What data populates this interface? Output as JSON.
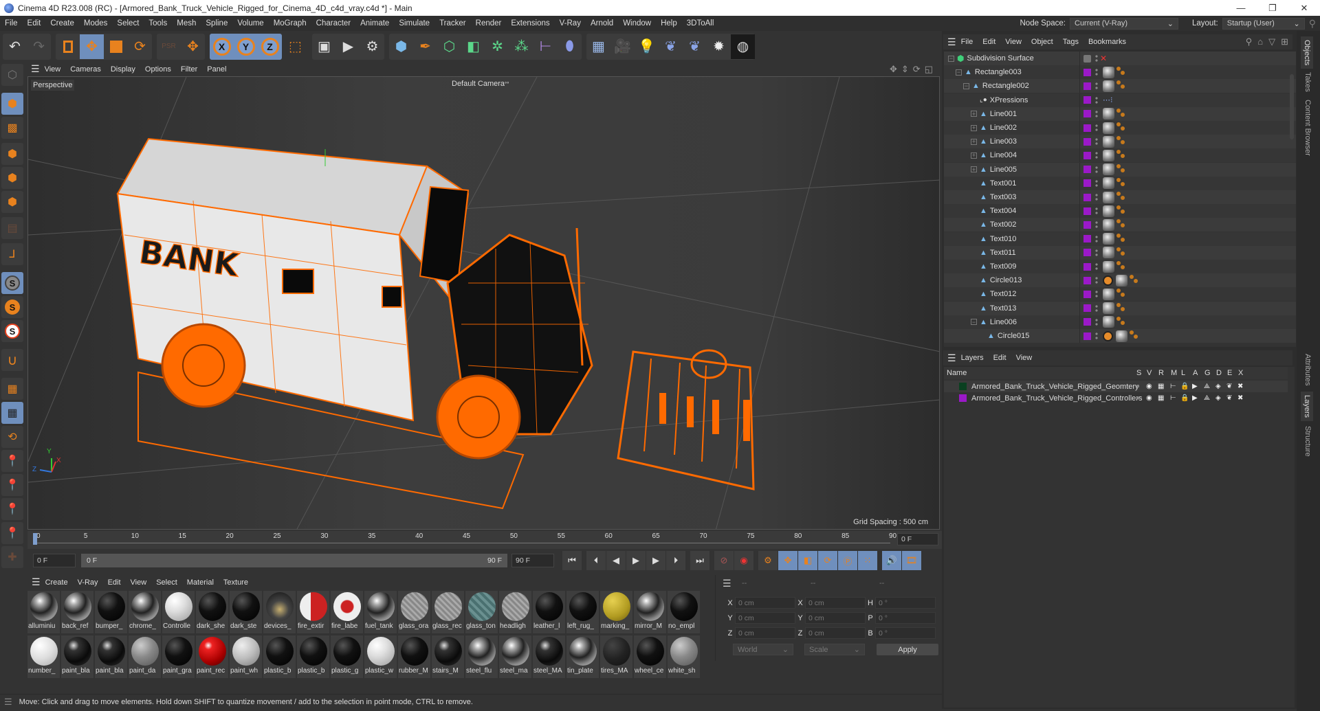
{
  "window": {
    "title": "Cinema 4D R23.008 (RC) - [Armored_Bank_Truck_Vehicle_Rigged_for_Cinema_4D_c4d_vray.c4d *] - Main",
    "minimize": "—",
    "maximize": "❐",
    "close": "✕"
  },
  "menubar": {
    "items": [
      "File",
      "Edit",
      "Create",
      "Modes",
      "Select",
      "Tools",
      "Mesh",
      "Spline",
      "Volume",
      "MoGraph",
      "Character",
      "Animate",
      "Simulate",
      "Tracker",
      "Render",
      "Extensions",
      "V-Ray",
      "Arnold",
      "Window",
      "Help",
      "3DToAll"
    ],
    "node_space_label": "Node Space:",
    "node_space_value": "Current (V-Ray)",
    "layout_label": "Layout:",
    "layout_value": "Startup (User)"
  },
  "toolbar": {
    "x_label": "X",
    "y_label": "Y",
    "z_label": "Z"
  },
  "viewport": {
    "menu": [
      "View",
      "Cameras",
      "Display",
      "Options",
      "Filter",
      "Panel"
    ],
    "view_name": "Perspective",
    "camera": "Default Camera",
    "camera_suffix": "°°",
    "grid_spacing": "Grid Spacing : 500 cm",
    "truck_text": "BANK",
    "axis": {
      "x": "X",
      "y": "Y",
      "z": "Z"
    }
  },
  "timeline": {
    "ticks": [
      "0",
      "5",
      "10",
      "15",
      "20",
      "25",
      "30",
      "35",
      "40",
      "45",
      "50",
      "55",
      "60",
      "65",
      "70",
      "75",
      "80",
      "85",
      "90"
    ],
    "current_frame": "0 F",
    "start_field": "0 F",
    "range_start": "0 F",
    "range_end": "90 F",
    "end_field": "90 F"
  },
  "materials": {
    "menu": [
      "Create",
      "V-Ray",
      "Edit",
      "View",
      "Select",
      "Material",
      "Texture"
    ],
    "items": [
      {
        "name": "alluminiu",
        "look": "chrome"
      },
      {
        "name": "back_ref",
        "look": "chrome"
      },
      {
        "name": "bumper_",
        "look": "black"
      },
      {
        "name": "chrome_",
        "look": "chrome"
      },
      {
        "name": "Controlle",
        "look": "white"
      },
      {
        "name": "dark_she",
        "look": "black"
      },
      {
        "name": "dark_ste",
        "look": "black"
      },
      {
        "name": "devices_",
        "look": "device"
      },
      {
        "name": "fire_extir",
        "look": "red-white"
      },
      {
        "name": "fire_labe",
        "look": "label"
      },
      {
        "name": "fuel_tank",
        "look": "chrome"
      },
      {
        "name": "glass_ora",
        "look": "glass"
      },
      {
        "name": "glass_rec",
        "look": "glass"
      },
      {
        "name": "glass_ton",
        "look": "teal"
      },
      {
        "name": "headligh",
        "look": "glass"
      },
      {
        "name": "leather_l",
        "look": "black"
      },
      {
        "name": "left_rug_",
        "look": "black"
      },
      {
        "name": "marking_",
        "look": "yellow"
      },
      {
        "name": "mirror_M",
        "look": "chrome"
      },
      {
        "name": "no_empl",
        "look": "black"
      },
      {
        "name": "number_",
        "look": "number"
      },
      {
        "name": "paint_bla",
        "look": "black-gloss"
      },
      {
        "name": "paint_bla",
        "look": "black-gloss"
      },
      {
        "name": "paint_da",
        "look": "grey"
      },
      {
        "name": "paint_gra",
        "look": "black"
      },
      {
        "name": "paint_rec",
        "look": "red"
      },
      {
        "name": "paint_wh",
        "look": "white-rough"
      },
      {
        "name": "plastic_b",
        "look": "black"
      },
      {
        "name": "plastic_b",
        "look": "black"
      },
      {
        "name": "plastic_g",
        "look": "black"
      },
      {
        "name": "plastic_w",
        "look": "white"
      },
      {
        "name": "rubber_M",
        "look": "black"
      },
      {
        "name": "stairs_M",
        "look": "black-gloss"
      },
      {
        "name": "steel_flu",
        "look": "chrome"
      },
      {
        "name": "steel_ma",
        "look": "chrome"
      },
      {
        "name": "steel_MA",
        "look": "black-gloss"
      },
      {
        "name": "tin_plate",
        "look": "chrome"
      },
      {
        "name": "tires_MA",
        "look": "dark-rough"
      },
      {
        "name": "wheel_ce",
        "look": "black"
      },
      {
        "name": "white_sh",
        "look": "grey"
      }
    ]
  },
  "coordinates": {
    "headers": [
      "--",
      "--",
      "--"
    ],
    "position": [
      {
        "axis": "X",
        "value": "0 cm"
      },
      {
        "axis": "Y",
        "value": "0 cm"
      },
      {
        "axis": "Z",
        "value": "0 cm"
      }
    ],
    "size": [
      {
        "axis": "X",
        "value": "0 cm"
      },
      {
        "axis": "Y",
        "value": "0 cm"
      },
      {
        "axis": "Z",
        "value": "0 cm"
      }
    ],
    "rotation": [
      {
        "axis": "H",
        "value": "0 °"
      },
      {
        "axis": "P",
        "value": "0 °"
      },
      {
        "axis": "B",
        "value": "0 °"
      }
    ],
    "mode_select": "World",
    "scale_select": "Scale",
    "apply_label": "Apply"
  },
  "status": {
    "text": "Move: Click and drag to move elements. Hold down SHIFT to quantize movement / add to the selection in point mode, CTRL to remove."
  },
  "objects_panel": {
    "menu": [
      "File",
      "Edit",
      "View",
      "Object",
      "Tags",
      "Bookmarks"
    ],
    "items": [
      {
        "name": "Subdivision Surface",
        "depth": 0,
        "icon": "subdivision",
        "expand": "minus",
        "tags": "subd"
      },
      {
        "name": "Rectangle003",
        "depth": 1,
        "icon": "spline",
        "expand": "minus",
        "tags": "std"
      },
      {
        "name": "Rectangle002",
        "depth": 2,
        "icon": "spline",
        "expand": "minus",
        "tags": "std"
      },
      {
        "name": "XPressions",
        "depth": 3,
        "icon": "xpresso",
        "expand": "none",
        "tags": "xpresso"
      },
      {
        "name": "Line001",
        "depth": 3,
        "icon": "spline",
        "expand": "plus",
        "tags": "std"
      },
      {
        "name": "Line002",
        "depth": 3,
        "icon": "spline",
        "expand": "plus",
        "tags": "std"
      },
      {
        "name": "Line003",
        "depth": 3,
        "icon": "spline",
        "expand": "plus",
        "tags": "std"
      },
      {
        "name": "Line004",
        "depth": 3,
        "icon": "spline",
        "expand": "plus",
        "tags": "std"
      },
      {
        "name": "Line005",
        "depth": 3,
        "icon": "spline",
        "expand": "plus",
        "tags": "std"
      },
      {
        "name": "Text001",
        "depth": 3,
        "icon": "spline",
        "expand": "none",
        "tags": "std"
      },
      {
        "name": "Text003",
        "depth": 3,
        "icon": "spline",
        "expand": "none",
        "tags": "std"
      },
      {
        "name": "Text004",
        "depth": 3,
        "icon": "spline",
        "expand": "none",
        "tags": "std"
      },
      {
        "name": "Text002",
        "depth": 3,
        "icon": "spline",
        "expand": "none",
        "tags": "std"
      },
      {
        "name": "Text010",
        "depth": 3,
        "icon": "spline",
        "expand": "none",
        "tags": "std"
      },
      {
        "name": "Text011",
        "depth": 3,
        "icon": "spline",
        "expand": "none",
        "tags": "std"
      },
      {
        "name": "Text009",
        "depth": 3,
        "icon": "spline",
        "expand": "none",
        "tags": "std"
      },
      {
        "name": "Circle013",
        "depth": 3,
        "icon": "spline",
        "expand": "none",
        "tags": "protect"
      },
      {
        "name": "Text012",
        "depth": 3,
        "icon": "spline",
        "expand": "none",
        "tags": "std"
      },
      {
        "name": "Text013",
        "depth": 3,
        "icon": "spline",
        "expand": "none",
        "tags": "std"
      },
      {
        "name": "Line006",
        "depth": 3,
        "icon": "spline",
        "expand": "minus",
        "tags": "std"
      },
      {
        "name": "Circle015",
        "depth": 4,
        "icon": "spline",
        "expand": "none",
        "tags": "protect"
      }
    ]
  },
  "side_tabs_top": [
    "Objects",
    "Takes",
    "Content Browser"
  ],
  "side_tabs_bottom": [
    "Attributes",
    "Layers",
    "Structure"
  ],
  "layers_panel": {
    "menu": [
      "Layers",
      "Edit",
      "View"
    ],
    "columns": [
      "Name",
      "S",
      "V",
      "R",
      "M",
      "L",
      "A",
      "G",
      "D",
      "E",
      "X"
    ],
    "items": [
      {
        "name": "Armored_Bank_Truck_Vehicle_Rigged_Geomtery",
        "color": "#0a4020"
      },
      {
        "name": "Armored_Bank_Truck_Vehicle_Rigged_Controllers",
        "color": "#9b19c8"
      }
    ]
  },
  "colors": {
    "accent_orange": "#ff6a00",
    "selection_blue": "#6f8fbd",
    "layer_purple": "#9b19c8"
  }
}
